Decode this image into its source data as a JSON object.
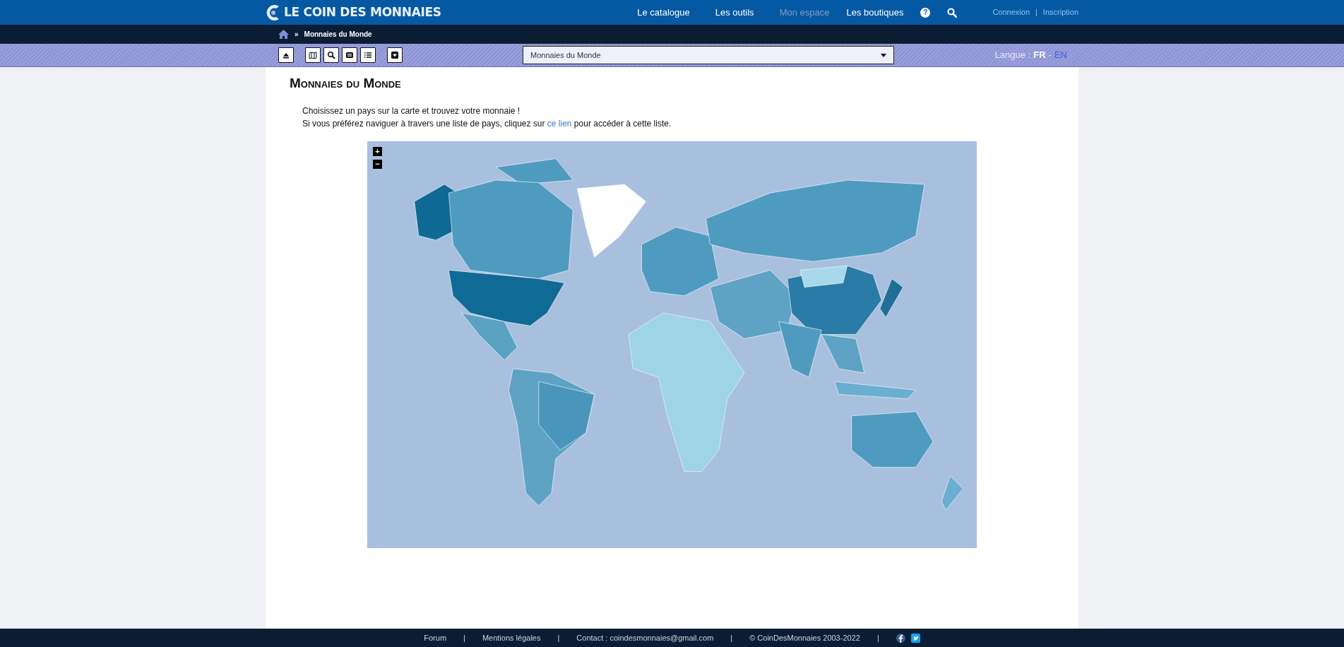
{
  "header": {
    "logo": "LE COIN DES MONNAIES",
    "nav": [
      {
        "label": "Le catalogue",
        "dropdown": true,
        "disabled": false
      },
      {
        "label": "Les outils",
        "dropdown": true,
        "disabled": false
      },
      {
        "label": "Mon espace",
        "dropdown": false,
        "disabled": true
      },
      {
        "label": "Les boutiques",
        "dropdown": false,
        "disabled": false
      }
    ],
    "help": "?",
    "auth": [
      "Connexion",
      "Inscription"
    ],
    "auth_separator": "|"
  },
  "breadcrumb": {
    "separator": "»",
    "current": "Monnaies du Monde"
  },
  "toolbar": {
    "select": {
      "value": "Monnaies du Monde"
    },
    "language": {
      "label": "Langue :",
      "separator": "-",
      "options": [
        {
          "label": "FR",
          "selected": true
        },
        {
          "label": "EN",
          "selected": false
        }
      ]
    }
  },
  "page": {
    "title": "Monnaies du Monde",
    "intro": "Choisissez un pays sur la carte et trouvez votre monnaie !",
    "text_before_link": "Si vous préférez naviguer à travers une liste de pays, cliquez sur",
    "link": "ce lien",
    "text_after_link": "pour accéder à cette liste."
  },
  "map": {
    "zoom_controls": [
      "+",
      "−"
    ]
  },
  "footer": {
    "separator": "|",
    "links": [
      "Forum",
      "Mentions légales",
      "Contact : coindesmonnaies@gmail.com",
      "© CoinDesMonnaies 2003-2022"
    ]
  }
}
